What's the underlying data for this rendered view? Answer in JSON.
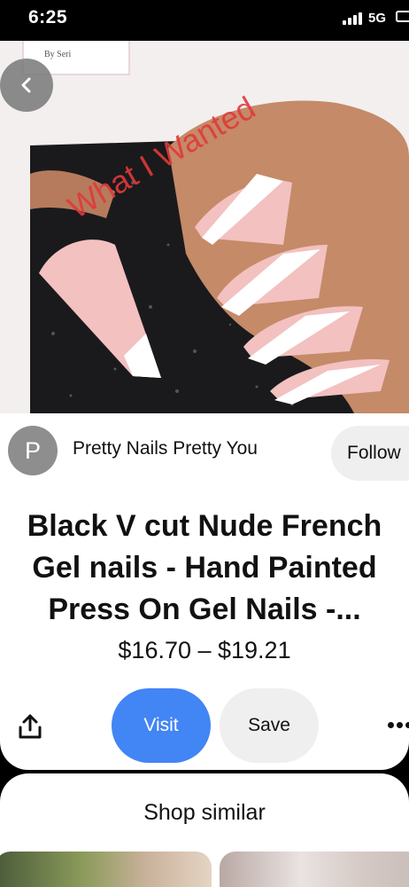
{
  "status_bar": {
    "time": "6:25",
    "network": "5G",
    "icons": [
      "signal-icon",
      "battery-icon"
    ]
  },
  "hero": {
    "overlay_text": "What I Wanted",
    "overlay_color": "#e03a3a",
    "box_text_line1": "By Seri",
    "back_icon": "chevron-left-icon"
  },
  "creator": {
    "avatar_initial": "P",
    "name": "Pretty Nails Pretty You",
    "follow_label": "Follow"
  },
  "pin": {
    "title": "Black V cut Nude French Gel nails - Hand Painted Press On Gel Nails -...",
    "price": "$16.70 – $19.21"
  },
  "actions": {
    "share_icon": "share-icon",
    "visit_label": "Visit",
    "save_label": "Save",
    "more_icon": "more-horizontal-icon",
    "visit_color": "#4285f4"
  },
  "shop_similar": {
    "title": "Shop similar"
  }
}
